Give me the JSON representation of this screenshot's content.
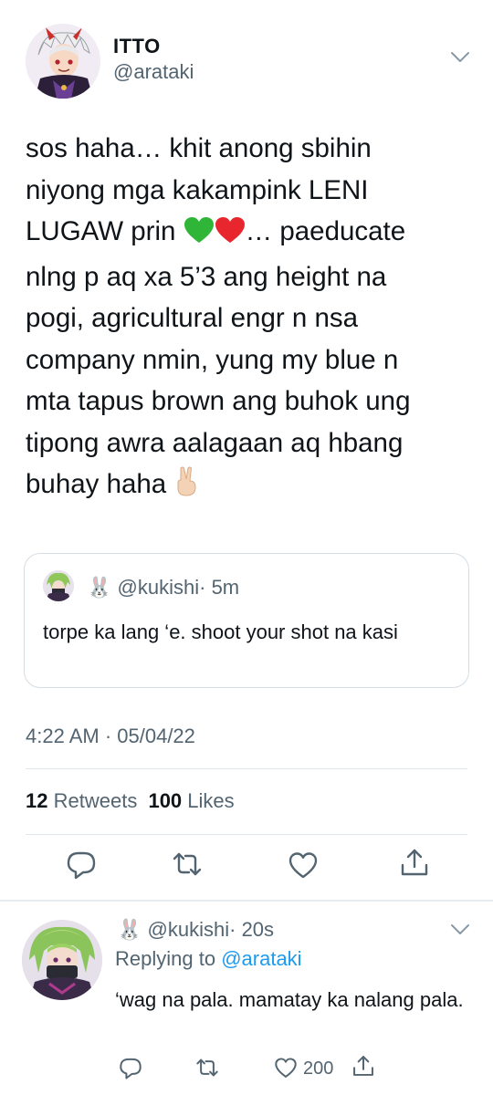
{
  "tweet": {
    "display_name": "ITTO",
    "handle": "@arataki",
    "text_lines": [
      "sos haha… khit anong sbihin",
      "niyong mga kakampink LENI",
      "nlng p aq xa 5’3 ang height na",
      "pogi, agricultural engr n nsa",
      "company nmin, yung my blue n",
      "mta tapus brown ang buhok ung",
      "tipong awra aalagaan aq hbang"
    ],
    "line3_before": "LUGAW prin",
    "line3_after": "… paeducate",
    "last_line": "buhay haha",
    "emojis": [
      "green-heart",
      "red-heart",
      "victory-hand"
    ],
    "timestamp": "4:22 AM · 05/04/22"
  },
  "quote": {
    "rabbit_emoji": "🐰",
    "handle": "@kukishi",
    "time": "· 5m",
    "text": "torpe ka lang ‘e. shoot your shot na kasi"
  },
  "stats": {
    "retweets_count": "12",
    "retweets_label": "Retweets",
    "likes_count": "100",
    "likes_label": "Likes"
  },
  "reply": {
    "rabbit_emoji": "🐰",
    "handle": "@kukishi",
    "time": "· 20s",
    "replying_prefix": "Replying to",
    "replying_handle": "@arataki",
    "text": "‘wag na pala. mamatay ka nalang pala.",
    "like_count": "200"
  },
  "icons": [
    "chevron-down-icon",
    "reply-icon",
    "retweet-icon",
    "like-icon",
    "share-icon"
  ],
  "colors": {
    "accent": "#1d9bf0",
    "secondary_text": "#536471",
    "text": "#0f1419",
    "divider": "#e1e8ed"
  }
}
